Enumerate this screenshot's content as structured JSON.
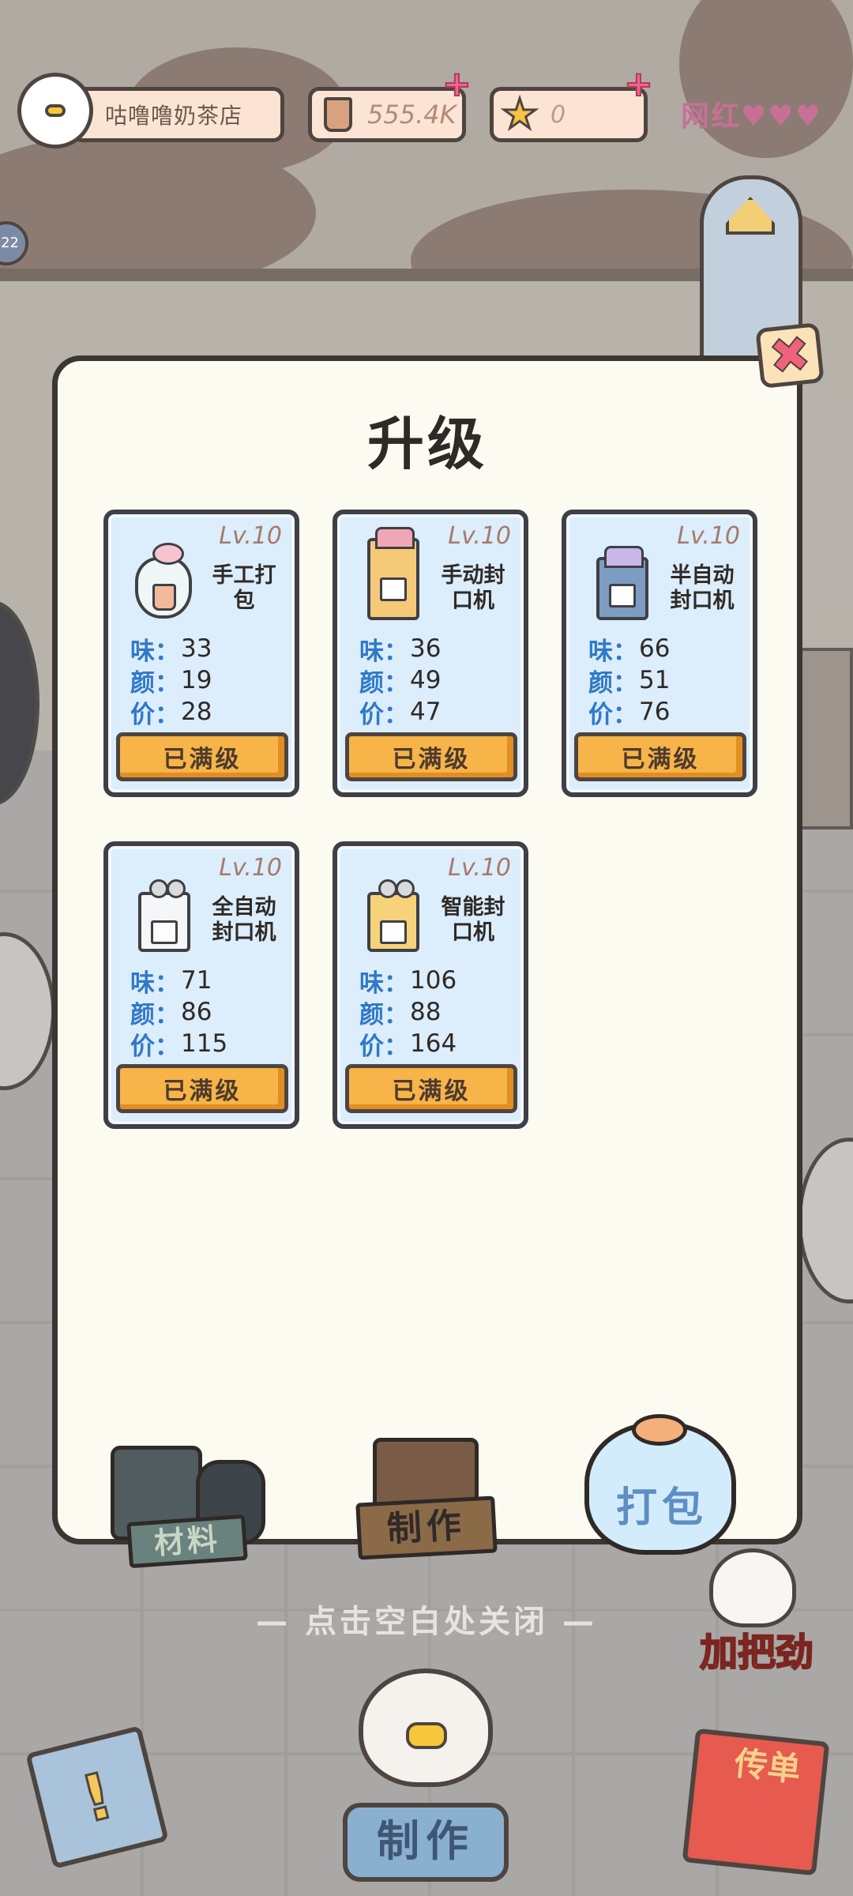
{
  "hud": {
    "shop_name": "咕噜噜奶茶店",
    "coins": "555.4K",
    "stars": "0",
    "brand": "网红",
    "side_badge": "22"
  },
  "modal": {
    "title": "升级",
    "close_icon": "close-x-icon",
    "stat_labels": {
      "taste": "味：",
      "look": "颜：",
      "price": "价："
    },
    "cards": [
      {
        "level": "Lv.10",
        "name": "手工打包",
        "taste": "33",
        "look": "19",
        "price": "28",
        "button": "已满级",
        "icon": "hand-bag-icon"
      },
      {
        "level": "Lv.10",
        "name": "手动封口机",
        "taste": "36",
        "look": "49",
        "price": "47",
        "button": "已满级",
        "icon": "manual-sealer-icon"
      },
      {
        "level": "Lv.10",
        "name": "半自动封口机",
        "taste": "66",
        "look": "51",
        "price": "76",
        "button": "已满级",
        "icon": "semi-auto-sealer-icon"
      },
      {
        "level": "Lv.10",
        "name": "全自动封口机",
        "taste": "71",
        "look": "86",
        "price": "115",
        "button": "已满级",
        "icon": "full-auto-sealer-icon"
      },
      {
        "level": "Lv.10",
        "name": "智能封口机",
        "taste": "106",
        "look": "88",
        "price": "164",
        "button": "已满级",
        "icon": "smart-sealer-icon"
      }
    ],
    "tabs": {
      "material": "材料",
      "make": "制作",
      "pack": "打包"
    }
  },
  "hint": "— 点击空白处关闭 —",
  "bottom": {
    "cheer": "加把劲",
    "make_button": "制作",
    "flyer": "传单"
  },
  "colors": {
    "card_bg": "#dcedfb",
    "button_orange": "#f6b449",
    "stat_blue": "#3079c8",
    "modal_bg": "#fcfbf1"
  }
}
